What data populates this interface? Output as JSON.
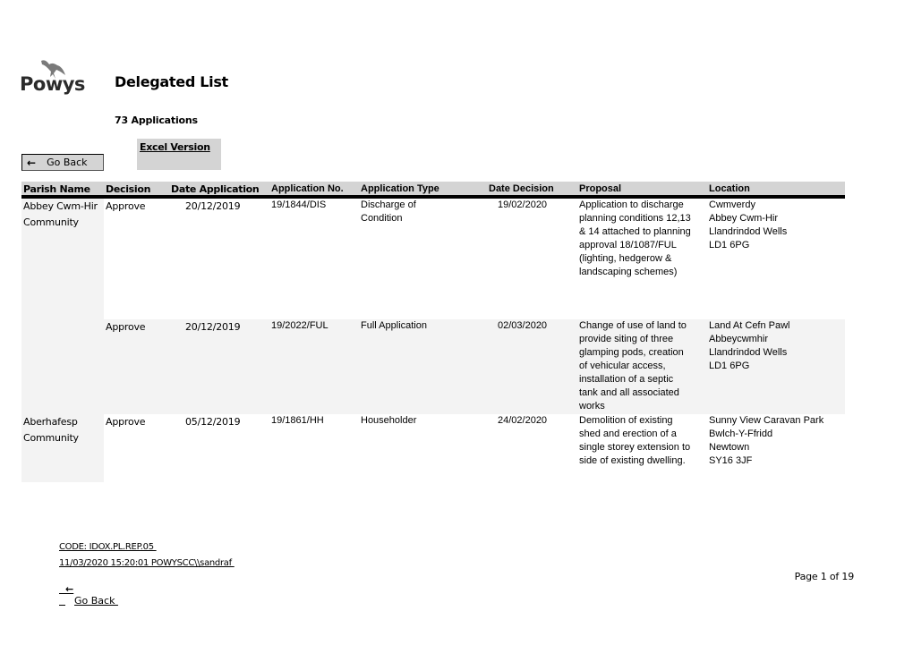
{
  "header": {
    "logo_text": "Powys",
    "title": "Delegated List",
    "application_count": "73 Applications",
    "excel_link": "Excel Version",
    "go_back": "Go Back"
  },
  "table": {
    "columns": [
      "Parish Name",
      "Decision",
      "Date Application",
      "Application No.",
      "Application Type",
      "Date Decision",
      "Proposal",
      "Location"
    ],
    "rows": [
      {
        "parish": [
          "Abbey Cwm-Hir",
          "Community"
        ],
        "decision": "Approve",
        "date_application": "20/12/2019",
        "application_no": "19/1844/DIS",
        "application_type": [
          "Discharge of",
          "Condition"
        ],
        "date_decision": "19/02/2020",
        "proposal": [
          "Application to discharge",
          "planning conditions 12,13",
          "& 14 attached to planning",
          "approval 18/1087/FUL",
          "(lighting, hedgerow &",
          "landscaping schemes)"
        ],
        "location": [
          "Cwmverdy",
          "Abbey Cwm-Hir",
          "Llandrindod Wells",
          "LD1 6PG"
        ]
      },
      {
        "parish": [
          "",
          ""
        ],
        "decision": "Approve",
        "date_application": "20/12/2019",
        "application_no": "19/2022/FUL",
        "application_type": [
          "Full Application",
          ""
        ],
        "date_decision": "02/03/2020",
        "proposal": [
          "Change of use of land to",
          "provide siting of three",
          "glamping pods, creation",
          "of vehicular access,",
          "installation of a septic",
          "tank and all associated",
          "works"
        ],
        "location": [
          "Land At Cefn Pawl",
          "Abbeycwmhir",
          "Llandrindod Wells",
          "LD1 6PG"
        ]
      },
      {
        "parish": [
          "Aberhafesp",
          "Community"
        ],
        "decision": "Approve",
        "date_application": "05/12/2019",
        "application_no": "19/1861/HH",
        "application_type": [
          "Householder",
          ""
        ],
        "date_decision": "24/02/2020",
        "proposal": [
          "Demolition of existing",
          "shed and erection of a",
          "single storey extension to",
          "side of existing dwelling."
        ],
        "location": [
          "Sunny View Caravan Park",
          "Bwlch-Y-Ffridd",
          "Newtown",
          "SY16 3JF"
        ]
      }
    ]
  },
  "footer": {
    "code": "CODE: IDOX.PL.REP.05 ",
    "timestamp_user": "11/03/2020 15:20:01 POWYSCC\\\\sandraf ",
    "go_back": "Go Back ",
    "page": "Page 1 of 19"
  },
  "icons": {
    "back_arrow": "🡐"
  },
  "colors": {
    "header_bg": "#d4d4d4",
    "alt_row_bg": "#f3f3f3",
    "rule": "#000000"
  }
}
